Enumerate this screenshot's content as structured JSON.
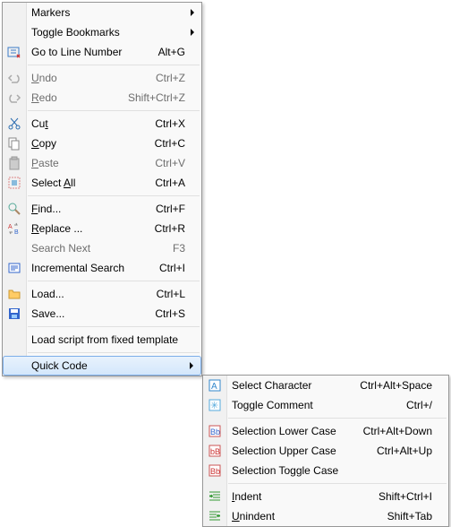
{
  "main": {
    "markers": "Markers",
    "toggle_bookmarks": "Toggle Bookmarks",
    "goto_line": "Go to Line Number",
    "goto_line_key": "Alt+G",
    "undo": "Undo",
    "undo_key": "Ctrl+Z",
    "redo": "Redo",
    "redo_key": "Shift+Ctrl+Z",
    "cut": "Cut",
    "cut_key": "Ctrl+X",
    "copy": "Copy",
    "copy_key": "Ctrl+C",
    "paste": "Paste",
    "paste_key": "Ctrl+V",
    "select_all": "Select All",
    "select_all_key": "Ctrl+A",
    "find": "Find...",
    "find_key": "Ctrl+F",
    "replace": "Replace ...",
    "replace_key": "Ctrl+R",
    "search_next": "Search Next",
    "search_next_key": "F3",
    "incremental": "Incremental Search",
    "incremental_key": "Ctrl+I",
    "load": "Load...",
    "load_key": "Ctrl+L",
    "save": "Save...",
    "save_key": "Ctrl+S",
    "load_template": "Load script from fixed template",
    "quick_code": "Quick Code"
  },
  "sub": {
    "select_char": "Select Character",
    "select_char_key": "Ctrl+Alt+Space",
    "toggle_comment": "Toggle Comment",
    "toggle_comment_key": "Ctrl+/",
    "lower": "Selection Lower Case",
    "lower_key": "Ctrl+Alt+Down",
    "upper": "Selection Upper Case",
    "upper_key": "Ctrl+Alt+Up",
    "toggle_case": "Selection Toggle Case",
    "indent": "Indent",
    "indent_key": "Shift+Ctrl+I",
    "unindent": "Unindent",
    "unindent_key": "Shift+Tab"
  }
}
